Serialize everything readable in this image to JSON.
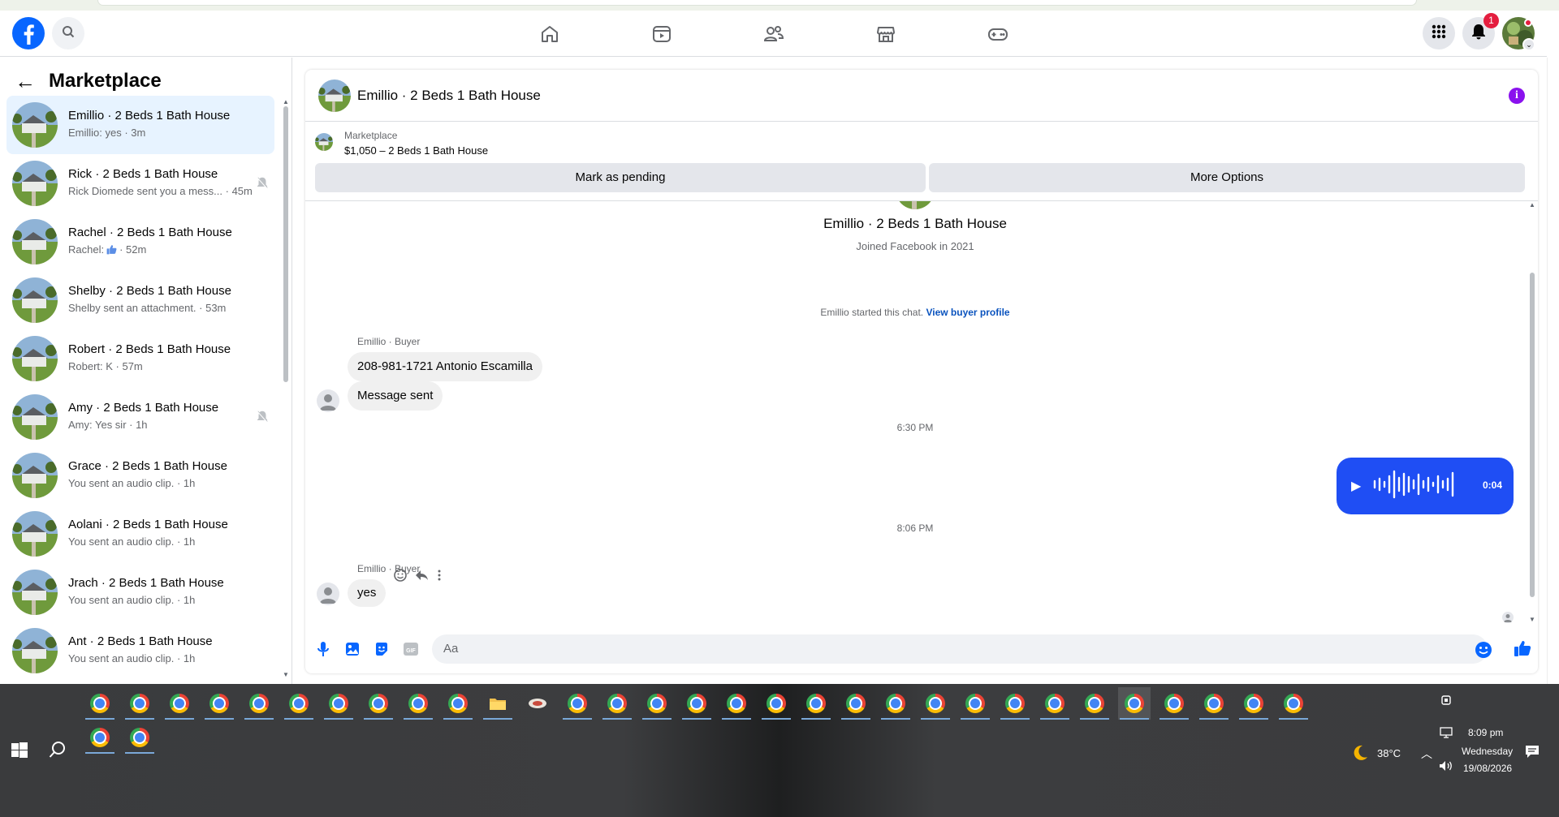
{
  "topnav": {
    "notification_count": "1",
    "icons": [
      "home-icon",
      "video-icon",
      "friends-icon",
      "marketplace-icon",
      "gaming-icon"
    ]
  },
  "sidebar": {
    "title": "Marketplace",
    "conversations": [
      {
        "name": "Emillio · 2 Beds 1 Bath House",
        "preview": "Emillio: yes · 3m",
        "active": true,
        "muted": false
      },
      {
        "name": "Rick · 2 Beds 1 Bath House",
        "preview": "Rick Diomede sent you a mess... · 45m",
        "active": false,
        "muted": true
      },
      {
        "name": "Rachel · 2 Beds 1 Bath House",
        "preview": "Rachel:",
        "preview_suffix": "· 52m",
        "has_like": true,
        "muted": false
      },
      {
        "name": "Shelby · 2 Beds 1 Bath House",
        "preview": "Shelby sent an attachment. · 53m",
        "muted": false
      },
      {
        "name": "Robert · 2 Beds 1 Bath House",
        "preview": "Robert: K · 57m",
        "muted": false
      },
      {
        "name": "Amy · 2 Beds 1 Bath House",
        "preview": "Amy: Yes sir · 1h",
        "muted": true
      },
      {
        "name": "Grace · 2 Beds 1 Bath House",
        "preview": "You sent an audio clip. · 1h",
        "muted": false
      },
      {
        "name": "Aolani · 2 Beds 1 Bath House",
        "preview": "You sent an audio clip. · 1h",
        "muted": false
      },
      {
        "name": "Jrach · 2 Beds 1 Bath House",
        "preview": "You sent an audio clip. · 1h",
        "muted": false
      },
      {
        "name": "Ant · 2 Beds 1 Bath House",
        "preview": "You sent an audio clip. · 1h",
        "muted": false
      }
    ]
  },
  "chat": {
    "title": "Emillio · 2 Beds 1 Bath House",
    "listing": {
      "category": "Marketplace",
      "price_title": "$1,050 – 2 Beds 1 Bath House",
      "mark_pending": "Mark as pending",
      "more_options": "More Options"
    },
    "profile": {
      "name": "Emillio · 2 Beds 1 Bath House",
      "joined": "Joined Facebook in 2021"
    },
    "started_text": "Emillio started this chat.",
    "view_buyer_profile": "View buyer profile",
    "messages": {
      "sender_label_1": "Emillio · Buyer",
      "bubble_1": "208-981-1721 Antonio Escamilla",
      "bubble_2": "Message sent",
      "time_1": "6:30 PM",
      "audio_duration": "0:04",
      "time_2": "8:06 PM",
      "sender_label_2": "Emillio · Buyer",
      "bubble_3": "yes"
    },
    "composer_placeholder": "Aa"
  },
  "taskbar": {
    "weather_temp": "38°C",
    "time": "8:09 pm",
    "day": "Wednesday",
    "date": "19/08/2026"
  },
  "colors": {
    "accent": "#0866ff",
    "audio_bubble": "#1f4ef4",
    "active_conv": "#e7f3ff",
    "info": "#8a11ee",
    "badge": "#e41e3f"
  }
}
